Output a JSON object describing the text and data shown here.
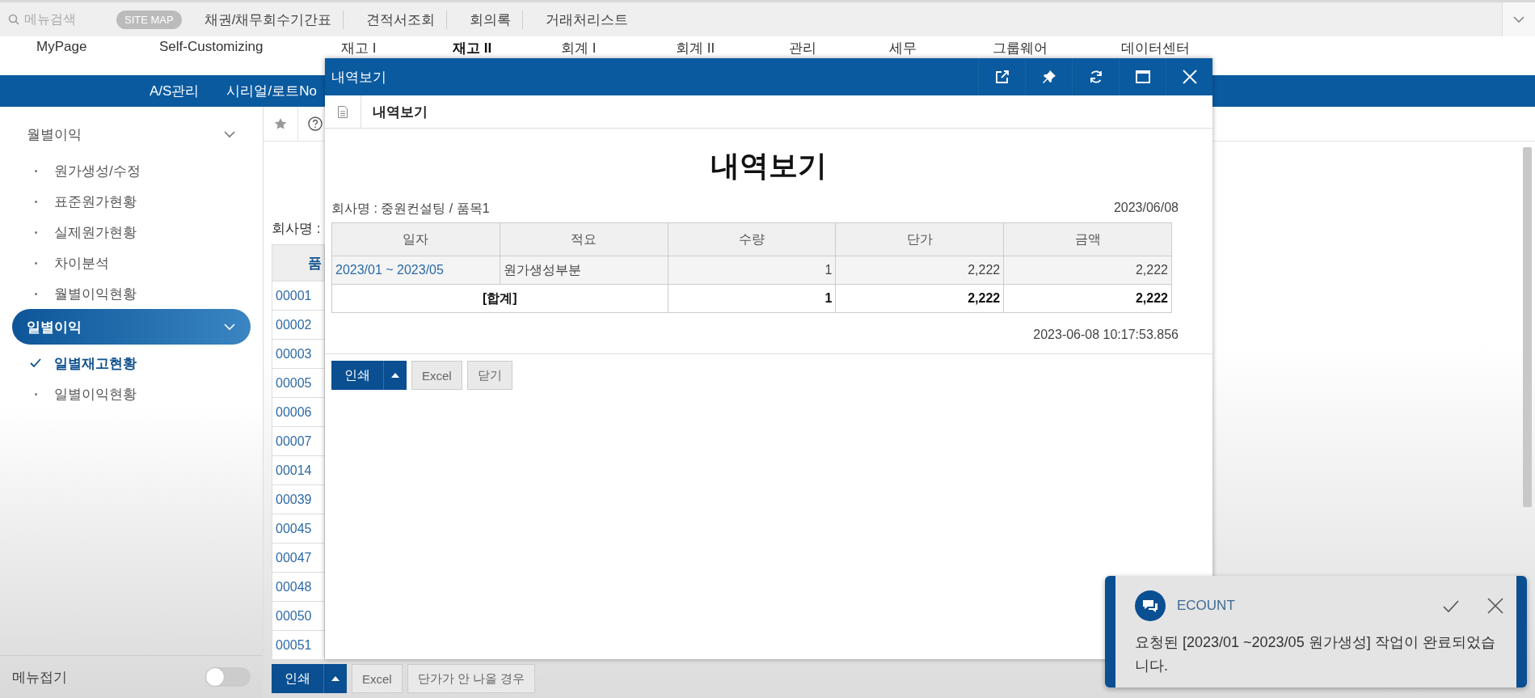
{
  "top_bar": {
    "search": {
      "placeholder": "메뉴검색"
    },
    "site_map": "SITE MAP",
    "links": [
      "채권/채무회수기간표",
      "견적서조회",
      "회의록",
      "거래처리스트"
    ]
  },
  "nav": {
    "items": [
      {
        "label": "MyPage",
        "selected": false
      },
      {
        "label": "Self-Customizing",
        "selected": false
      },
      {
        "label": "재고 I",
        "selected": false
      },
      {
        "label": "재고 II",
        "selected": true
      },
      {
        "label": "회계 I",
        "selected": false
      },
      {
        "label": "회계 II",
        "selected": false
      },
      {
        "label": "관리",
        "selected": false
      },
      {
        "label": "세무",
        "selected": false
      },
      {
        "label": "그룹웨어",
        "selected": false
      },
      {
        "label": "데이터센터",
        "selected": false
      }
    ]
  },
  "sub_nav": {
    "items": [
      "A/S관리",
      "시리얼/로트No"
    ]
  },
  "sidebar": {
    "groups": [
      {
        "label": "월별이익",
        "selected": false,
        "expanded": true,
        "children": [
          {
            "label": "원가생성/수정",
            "selected": false
          },
          {
            "label": "표준원가현황",
            "selected": false
          },
          {
            "label": "실제원가현황",
            "selected": false
          },
          {
            "label": "차이분석",
            "selected": false
          },
          {
            "label": "월별이익현황",
            "selected": false
          }
        ]
      },
      {
        "label": "일별이익",
        "selected": true,
        "expanded": true,
        "children": [
          {
            "label": "일별재고현황",
            "selected": true
          },
          {
            "label": "일별이익현황",
            "selected": false
          }
        ]
      }
    ],
    "collapse": {
      "label": "메뉴접기",
      "on": false
    }
  },
  "main": {
    "company_label": "회사명 :",
    "table": {
      "columns": [
        "품"
      ],
      "rows": [
        "00001",
        "00002",
        "00003",
        "00005",
        "00006",
        "00007",
        "00014",
        "00039",
        "00045",
        "00047",
        "00048",
        "00050",
        "00051"
      ]
    },
    "buttons": [
      {
        "label": "인쇄",
        "kind": "split"
      },
      {
        "label": "Excel",
        "kind": "plain"
      },
      {
        "label": "단가가 안 나올 경우",
        "kind": "plain"
      }
    ]
  },
  "modal": {
    "title": "내역보기",
    "tab": "내역보기",
    "heading": "내역보기",
    "company": "회사명 : 중원컨설팅 / 품목1",
    "date": "2023/06/08",
    "table": {
      "columns": [
        "일자",
        "적요",
        "수량",
        "단가",
        "금액"
      ],
      "rows": [
        {
          "kind": "data",
          "cells": [
            "2023/01 ~ 2023/05",
            "원가생성부분",
            "1",
            "2,222",
            "2,222"
          ]
        },
        {
          "kind": "total",
          "cells": [
            {
              "text": "[합계]",
              "colspan": 2
            },
            {
              "text": "1"
            },
            {
              "text": "2,222"
            },
            {
              "text": "2,222"
            }
          ]
        }
      ]
    },
    "timestamp": "2023-06-08 10:17:53.856",
    "buttons": [
      {
        "label": "인쇄",
        "kind": "split"
      },
      {
        "label": "Excel",
        "kind": "plain"
      },
      {
        "label": "닫기",
        "kind": "plain"
      }
    ]
  },
  "toast": {
    "title": "ECOUNT",
    "message": "요청된 [2023/01 ~2023/05 원가생성] 작업이 완료되었습니다."
  }
}
